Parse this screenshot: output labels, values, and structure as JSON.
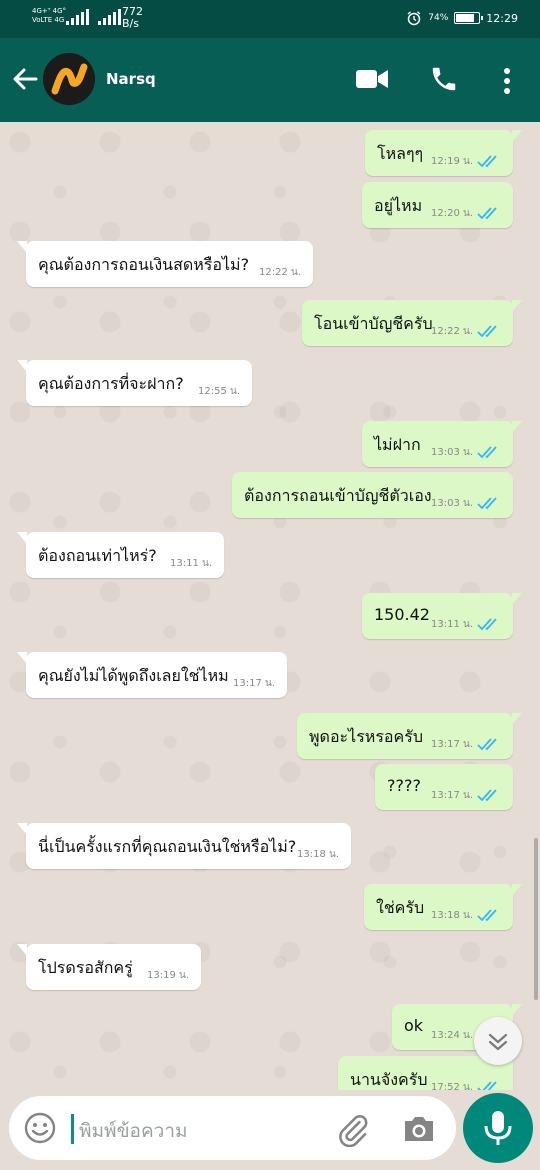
{
  "status_bar": {
    "net1": "4G+ᵀ 4G°",
    "net2": "VoLTE 4G",
    "speed_value": "772",
    "speed_unit": "B/s",
    "battery": "74%",
    "time": "12:29"
  },
  "app_bar": {
    "contact_name": "Narsq"
  },
  "messages": [
    {
      "dir": "out",
      "text": "โหลๆๆ",
      "time": "12:19 น.",
      "read": true
    },
    {
      "dir": "out",
      "text": "อยู่ไหม",
      "time": "12:20 น.",
      "read": true
    },
    {
      "dir": "in",
      "text": "คุณต้องการถอนเงินสดหรือไม่?",
      "time": "12:22 น."
    },
    {
      "dir": "out",
      "text": "โอนเข้าบัญชีครับ",
      "time": "12:22 น.",
      "read": true
    },
    {
      "dir": "in",
      "text": "คุณต้องการที่จะฝาก?",
      "time": "12:55 น."
    },
    {
      "dir": "out",
      "text": "ไม่ฝาก",
      "time": "13:03 น.",
      "read": true
    },
    {
      "dir": "out",
      "text": "ต้องการถอนเข้าบัญชีตัวเอง",
      "time": "13:03 น.",
      "read": true
    },
    {
      "dir": "in",
      "text": "ต้องถอนเท่าไหร่?",
      "time": "13:11 น."
    },
    {
      "dir": "out",
      "text": "150.42",
      "time": "13:11 น.",
      "read": true
    },
    {
      "dir": "in",
      "text": "คุณยังไม่ได้พูดถึงเลยใช่ไหม",
      "time": "13:17 น."
    },
    {
      "dir": "out",
      "text": "พูดอะไรหรอครับ",
      "time": "13:17 น.",
      "read": true
    },
    {
      "dir": "out",
      "text": "????",
      "time": "13:17 น.",
      "read": true
    },
    {
      "dir": "in",
      "text": "นี่เป็นครั้งแรกที่คุณถอนเงินใช่หรือไม่?",
      "time": "13:18 น."
    },
    {
      "dir": "out",
      "text": "ใช่ครับ",
      "time": "13:18 น.",
      "read": true
    },
    {
      "dir": "in",
      "text": "โปรดรอสักครู่",
      "time": "13:19 น."
    },
    {
      "dir": "out",
      "text": "ok",
      "time": "13:24 น.",
      "read": true
    },
    {
      "dir": "out",
      "text": "นานจังครับ",
      "time": "17:52 น.",
      "read": true
    }
  ],
  "input": {
    "placeholder": "พิมพ์ข้อความ"
  },
  "colors": {
    "header": "#075e54",
    "status_bar": "#054c44",
    "outgoing_bubble": "#dcf8c6",
    "incoming_bubble": "#ffffff",
    "read_ticks": "#34b7f1",
    "mic_button": "#00897b"
  },
  "icons": [
    "back-arrow-icon",
    "video-call-icon",
    "phone-icon",
    "more-vert-icon",
    "emoji-icon",
    "attach-icon",
    "camera-icon",
    "mic-icon",
    "double-chevron-down-icon",
    "double-check-icon"
  ]
}
